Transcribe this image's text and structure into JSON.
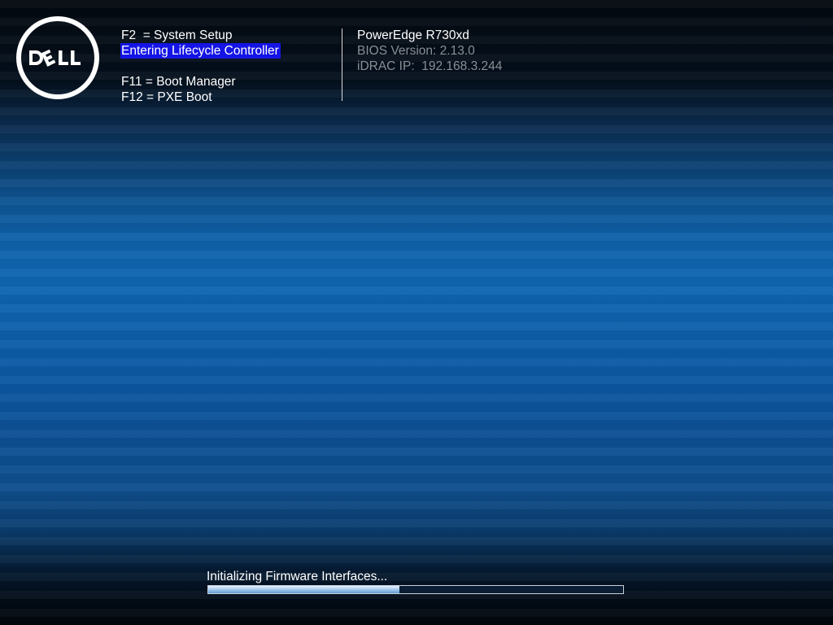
{
  "brand": {
    "logo_text": "DELL"
  },
  "hotkeys": [
    {
      "key": "F2 ",
      "separator": " = ",
      "action": "System Setup"
    },
    {
      "status": "Entering Lifecycle Controller"
    },
    {
      "key": "F11",
      "separator": " = ",
      "action": "Boot Manager"
    },
    {
      "key": "F12",
      "separator": " = ",
      "action": "PXE Boot"
    }
  ],
  "lines": {
    "f2": "F2  = System Setup",
    "lifecycle": "Entering Lifecycle Controller",
    "f11": "F11 = Boot Manager",
    "f12": "F12 = PXE Boot"
  },
  "system": {
    "model": "PowerEdge R730xd",
    "bios": "BIOS Version: 2.13.0",
    "idrac": "iDRAC IP:  192.168.3.244"
  },
  "progress": {
    "label": "Initializing Firmware Interfaces...",
    "percent": 46
  },
  "colors": {
    "highlight": "#1414e6",
    "dim_text": "#8a8f96",
    "progress_fill": "#a9cdef"
  }
}
